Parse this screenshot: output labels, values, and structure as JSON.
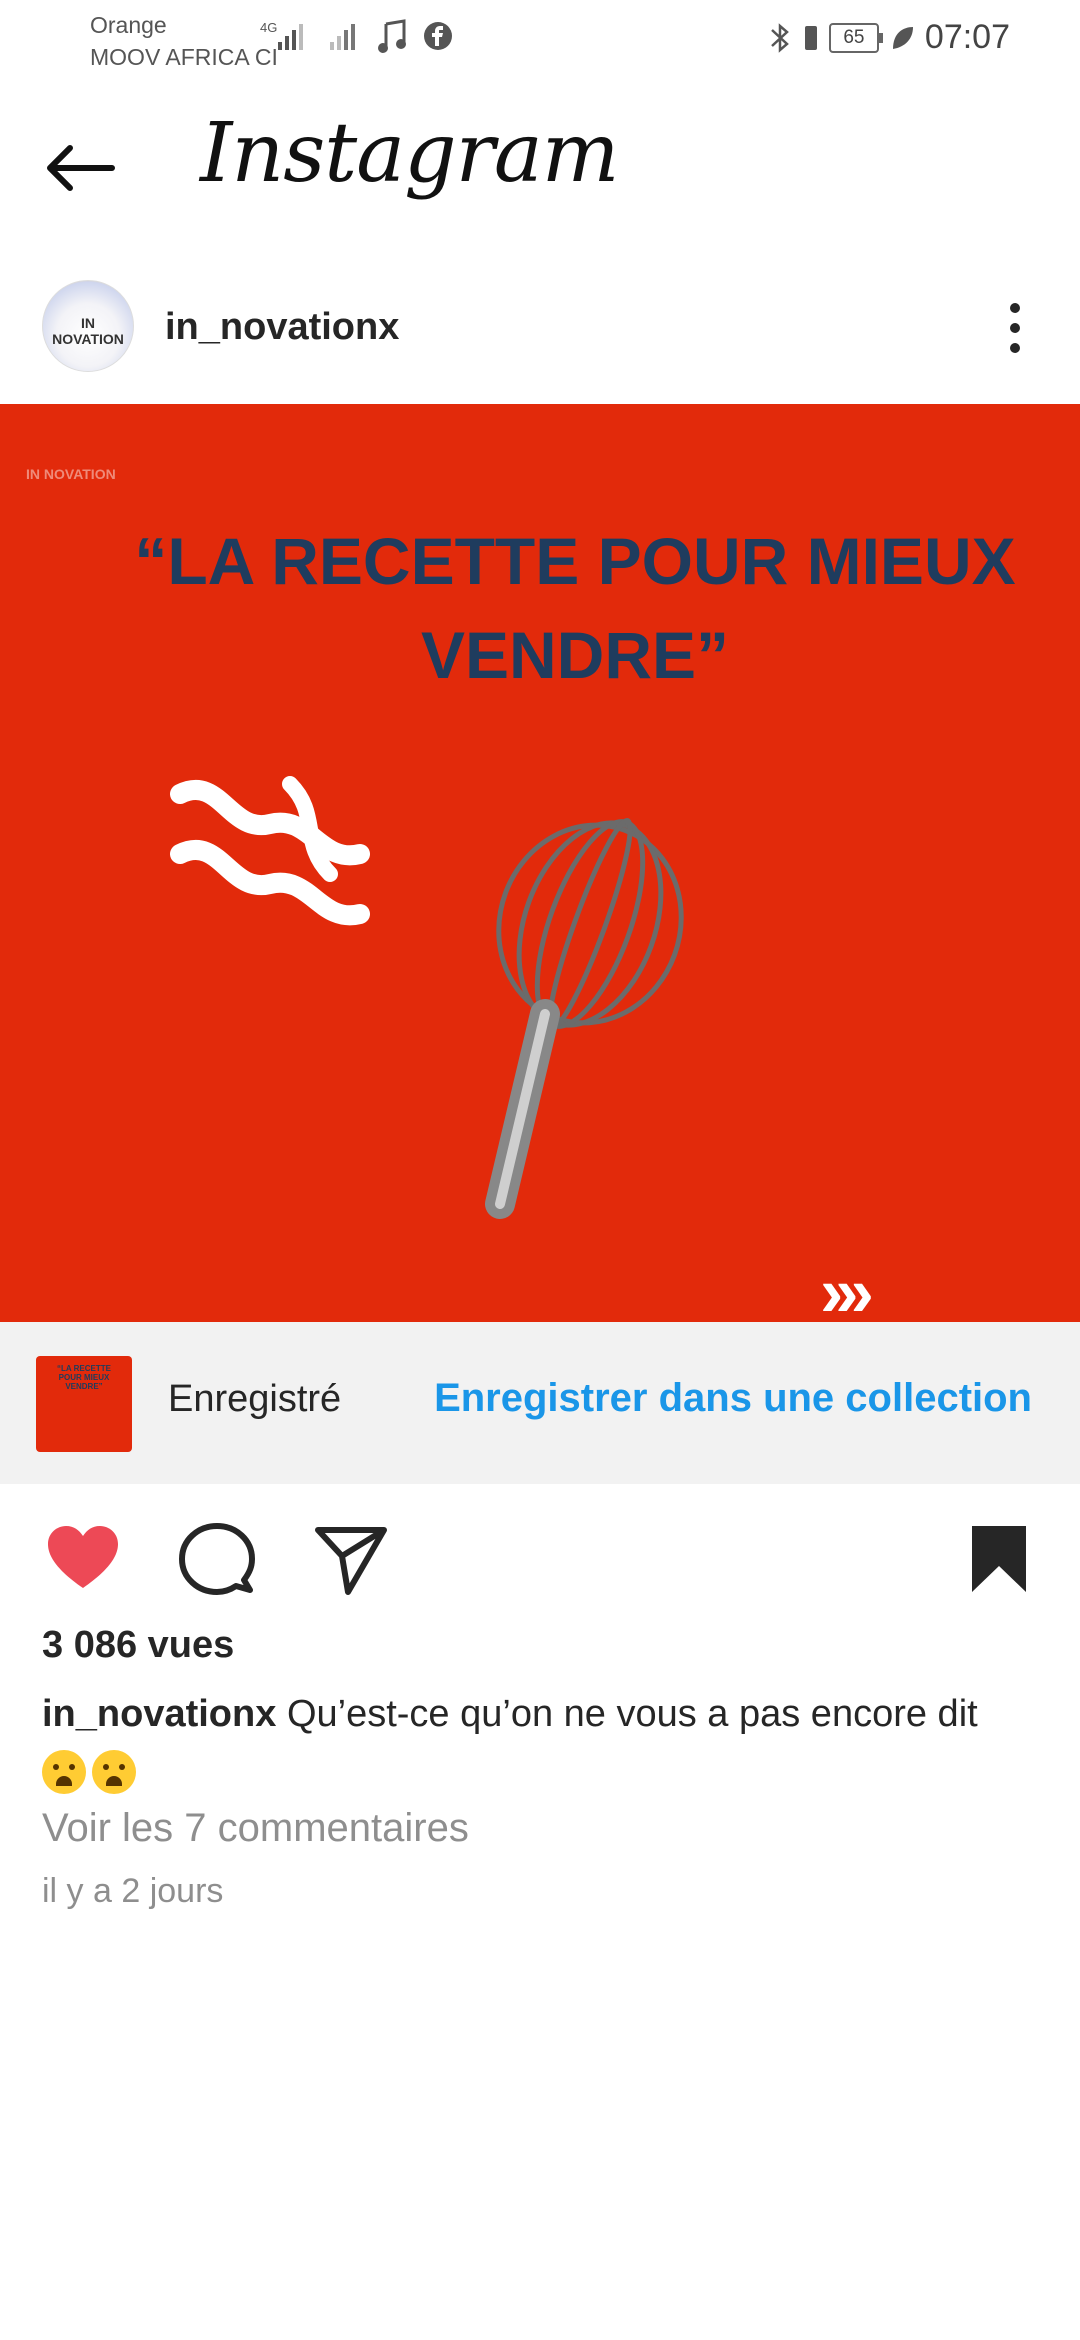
{
  "status_bar": {
    "carrier_line1": "Orange",
    "carrier_line2": "MOOV AFRICA CI",
    "network": "4G",
    "battery": "65",
    "time": "07:07"
  },
  "header": {
    "title": "Instagram",
    "back_icon": "arrow-left-icon"
  },
  "post": {
    "username": "in_novationx",
    "avatar_text": "IN NOVATION",
    "image": {
      "watermark": "IN NOVATION",
      "headline": "“LA RECETTE POUR MIEUX VENDRE”",
      "background_color": "#e22a0b",
      "headline_color": "#1f3c5e"
    },
    "saved_bar": {
      "thumb_text": "“LA RECETTE POUR MIEUX VENDRE”",
      "status": "Enregistré",
      "action": "Enregistrer dans une collection",
      "action_color": "#1a96e8"
    },
    "actions": {
      "like_icon": "heart-filled-icon",
      "like_color": "#ed4956",
      "comment_icon": "comment-icon",
      "share_icon": "send-icon",
      "bookmark_icon": "bookmark-filled-icon"
    },
    "views": "3 086 vues",
    "caption_user": "in_novationx",
    "caption_text": "Qu’est-ce qu’on ne vous a pas encore dit",
    "view_comments": "Voir les 7 commentaires",
    "time_ago": "il y a 2 jours"
  }
}
